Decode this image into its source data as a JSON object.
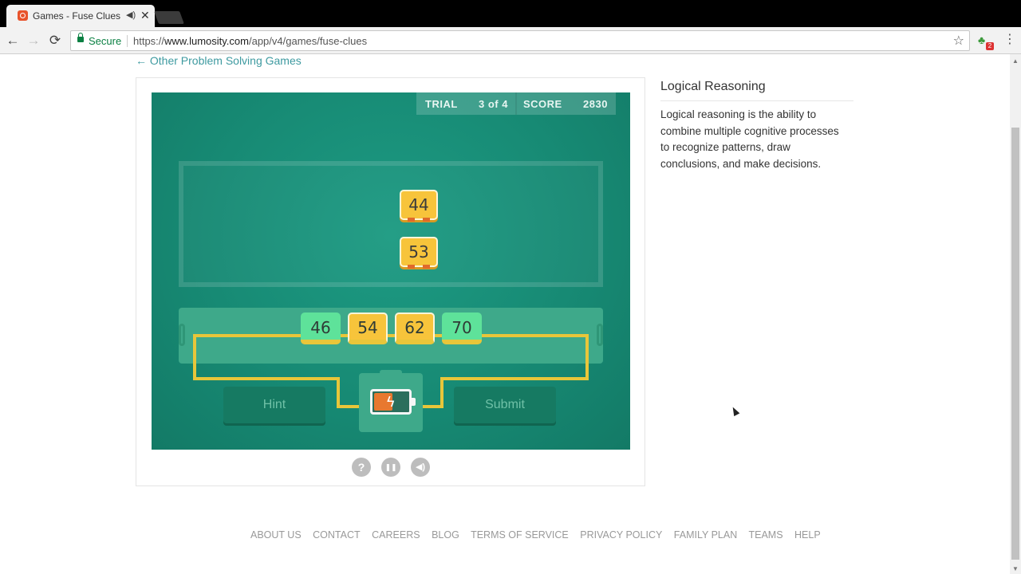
{
  "browser": {
    "tab_title": "Games - Fuse Clues -",
    "tab_audio_icon": "speaker-icon",
    "tab_close": "✕",
    "secure_label": "Secure",
    "url_prefix": "https://",
    "url_host": "www.lumosity.com",
    "url_path": "/app/v4/games/fuse-clues",
    "extension_badge": "2",
    "back_glyph": "←",
    "forward_glyph": "→",
    "reload_glyph": "⟳",
    "star_glyph": "☆",
    "menu_glyph": "⋮"
  },
  "page": {
    "back_link": "← Other Problem Solving Games"
  },
  "game": {
    "hud": {
      "trial_label": "TRIAL",
      "trial_value": "3 of 4",
      "score_label": "SCORE",
      "score_value": "2830"
    },
    "clues": [
      "44",
      "53"
    ],
    "slots": [
      {
        "value": "46",
        "color": "green"
      },
      {
        "value": "54",
        "color": "yellow"
      },
      {
        "value": "62",
        "color": "yellow"
      },
      {
        "value": "70",
        "color": "green"
      }
    ],
    "hint_label": "Hint",
    "submit_label": "Submit",
    "battery_level": 0.5,
    "colors": {
      "background": "#178a74",
      "chip_yellow": "#f7c43b",
      "chip_green": "#5ee29a",
      "wire": "#e8c63a"
    }
  },
  "controls": {
    "help": "?",
    "pause": "❚❚",
    "sound": "🔊"
  },
  "sidebar": {
    "title": "Logical Reasoning",
    "description": "Logical reasoning is the ability to combine multiple cognitive processes to recognize patterns, draw conclusions, and make decisions."
  },
  "footer": {
    "links": [
      "ABOUT US",
      "CONTACT",
      "CAREERS",
      "BLOG",
      "TERMS OF SERVICE",
      "PRIVACY POLICY",
      "FAMILY PLAN",
      "TEAMS",
      "HELP"
    ]
  }
}
